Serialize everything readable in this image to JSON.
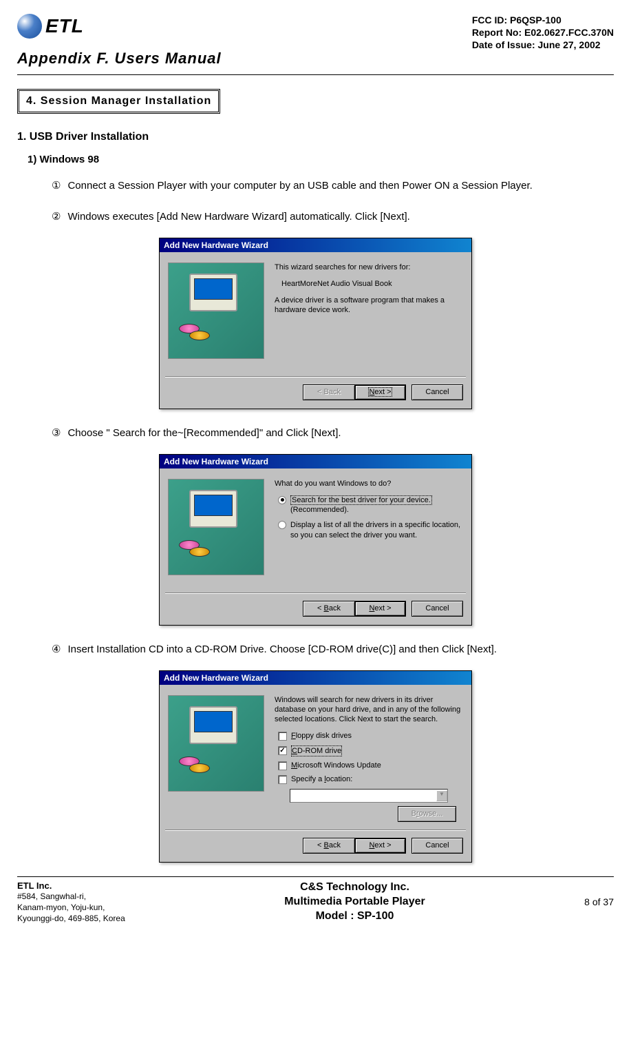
{
  "header": {
    "logo_text": "ETL",
    "fcc": "FCC ID: P6QSP-100",
    "report": "Report No: E02.0627.FCC.370N",
    "date": "Date of Issue: June 27, 2002",
    "appendix": "Appendix F.  Users Manual"
  },
  "section_box": "4. Session Manager Installation",
  "h1": "1. USB Driver Installation",
  "h2": "1) Windows 98",
  "steps": {
    "s1_marker": "①",
    "s1": "Connect a Session Player with your computer by an USB cable and then Power ON a Session Player.",
    "s2_marker": "②",
    "s2": "Windows executes [Add New Hardware Wizard] automatically. Click [Next].",
    "s3_marker": "③",
    "s3": "Choose \" Search for the~[Recommended]\"  and Click [Next].",
    "s4_marker": "④",
    "s4": "Insert Installation CD into a CD-ROM Drive. Choose [CD-ROM drive(C)] and then Click [Next]."
  },
  "wizard_title": "Add New Hardware Wizard",
  "wiz1": {
    "p1": "This wizard searches for new drivers for:",
    "p2": "HeartMoreNet Audio Visual Book",
    "p3": "A device driver is a software program that makes a hardware device work."
  },
  "wiz2": {
    "prompt": "What do you want Windows to do?",
    "opt1a": "Search for the best driver for your device.",
    "opt1b": "(Recommended).",
    "opt2": "Display a list of all the drivers in a specific location, so you can select the driver you want."
  },
  "wiz3": {
    "p1": "Windows will search for new drivers in its driver database on your hard drive, and in any of the following selected locations. Click Next to start the search.",
    "cb1": "Floppy disk drives",
    "cb2": "CD-ROM drive",
    "cb3": "Microsoft Windows Update",
    "cb4": "Specify a location:"
  },
  "buttons": {
    "back": "< Back",
    "next": "Next >",
    "cancel": "Cancel",
    "browse": "Browse..."
  },
  "footer": {
    "company": "ETL Inc.",
    "addr1": "#584, Sangwhal-ri,",
    "addr2": "Kanam-myon, Yoju-kun,",
    "addr3": "Kyounggi-do, 469-885, Korea",
    "center1": "C&S Technology Inc.",
    "center2": "Multimedia Portable Player",
    "center3": "Model : SP-100",
    "page": "8 of 37"
  }
}
